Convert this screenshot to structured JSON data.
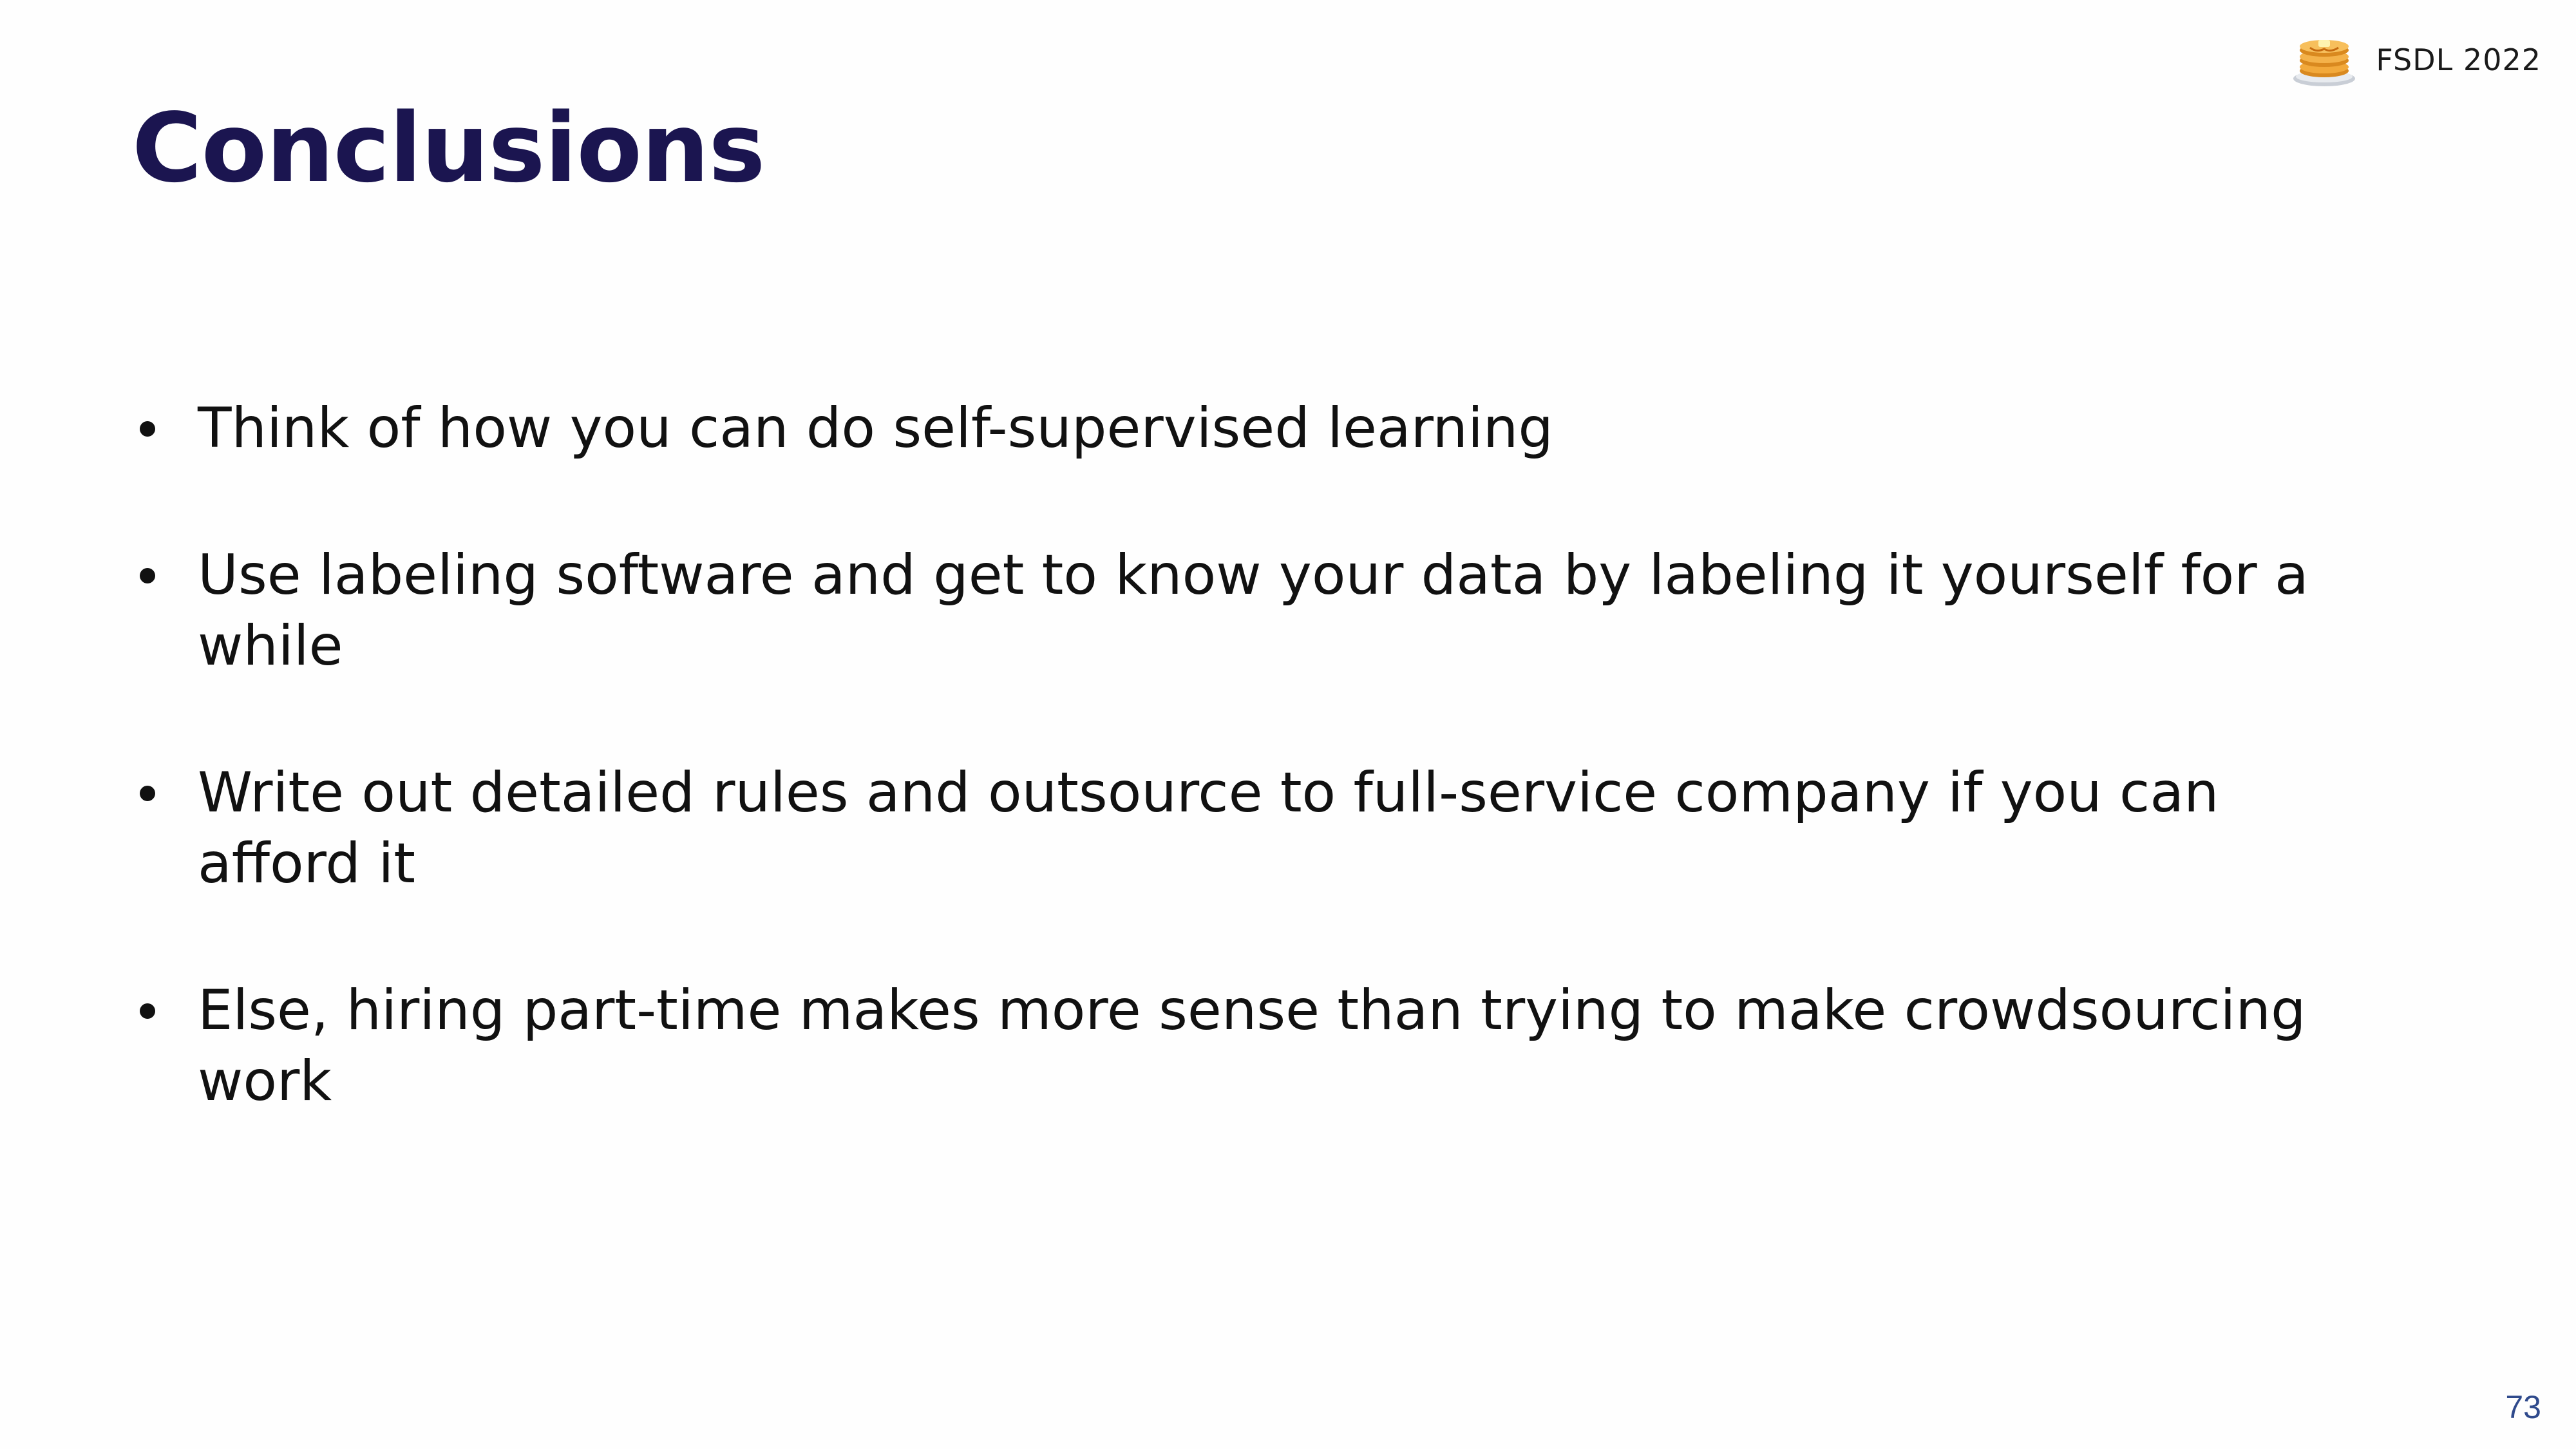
{
  "slide": {
    "title": "Conclusions",
    "brand": {
      "logo_icon": "pancake-stack-icon",
      "label": "FSDL 2022"
    },
    "bullets": [
      {
        "text": "Think of how you can do self-supervised learning"
      },
      {
        "text": "Use labeling software and get to know your data by labeling it yourself for a while"
      },
      {
        "text": "Write out detailed rules and outsource to full-service company if you can afford it"
      },
      {
        "text": "Else, hiring part-time makes more sense than trying to make crowdsourcing work"
      }
    ],
    "page_number": "73",
    "colors": {
      "title": "#1b1550",
      "page_number": "#2f4a8c",
      "body_text": "#111111"
    }
  }
}
